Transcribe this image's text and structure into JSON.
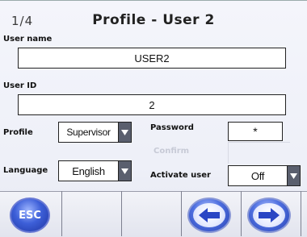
{
  "header": {
    "page_indicator": "1/4",
    "title": "Profile - User 2"
  },
  "form": {
    "user_name_label": "User name",
    "user_name_value": "USER2",
    "user_id_label": "User ID",
    "user_id_value": "2",
    "profile_label": "Profile",
    "profile_value": "Supervisor",
    "password_label": "Password",
    "password_value": "*",
    "confirm_label": "Confirm",
    "language_label": "Language",
    "language_value": "English",
    "activate_user_label": "Activate user",
    "activate_user_value": "Off"
  },
  "footer": {
    "esc_label": "ESC",
    "prev_icon": "arrow-left-icon",
    "next_icon": "arrow-right-icon"
  },
  "colors": {
    "background": "#eef0f8",
    "dropdown_arrow": "#5a5f6e",
    "button_blue": "#3d5fd8",
    "disabled_text": "#c7cad6"
  }
}
